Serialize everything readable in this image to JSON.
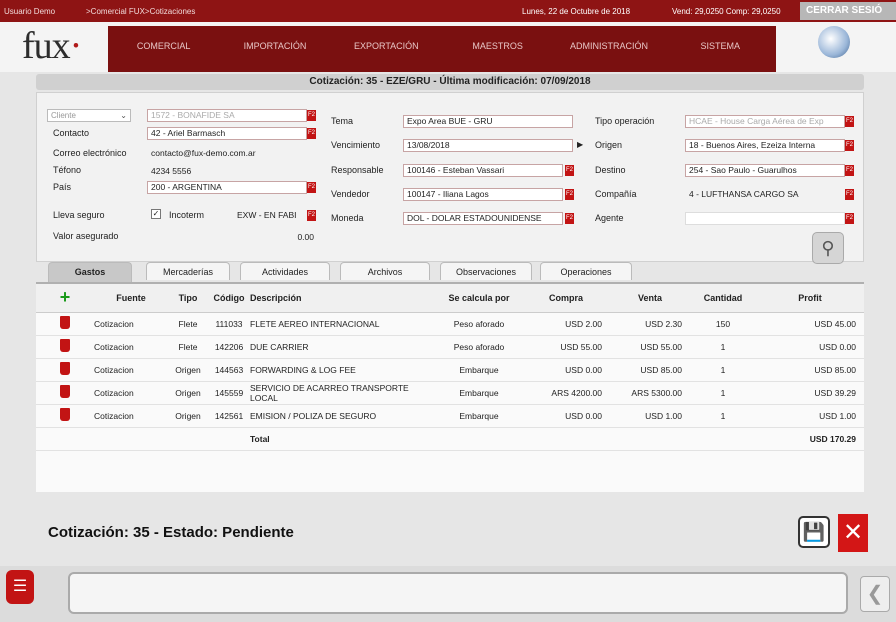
{
  "topbar": {
    "user": "Usuario Demo",
    "breadcrumb": ">Comercial FUX>Cotizaciones",
    "date": "Lunes, 22 de Octubre de 2018",
    "rates": "Vend: 29,0250 Comp: 29,0250",
    "logout": "CERRAR SESIÓ"
  },
  "logo": {
    "text": "fux",
    "dot": "·"
  },
  "nav": [
    "COMERCIAL",
    "IMPORTACIÓN",
    "EXPORTACIÓN",
    "MAESTROS",
    "ADMINISTRACIÓN",
    "SISTEMA"
  ],
  "title": "Cotización: 35 - EZE/GRU - Última modificación: 07/09/2018",
  "form": {
    "cliente_select": "Cliente",
    "cliente": "1572 - BONAFIDE SA",
    "contacto_label": "Contacto",
    "contacto": "42 - Ariel Barmasch",
    "correo_label": "Correo electrónico",
    "correo": "contacto@fux-demo.com.ar",
    "telefono_label": "Téfono",
    "telefono": "4234 5556",
    "pais_label": "País",
    "pais": "200 - ARGENTINA",
    "seguro_label": "Lleva seguro",
    "incoterm_label": "Incoterm",
    "incoterm": "EXW - EN FABI",
    "valor_label": "Valor asegurado",
    "valor": "0.00",
    "tema_label": "Tema",
    "tema": "Expo Area BUE - GRU",
    "venc_label": "Vencimiento",
    "venc": "13/08/2018",
    "resp_label": "Responsable",
    "resp": "100146 - Esteban Vassari",
    "vend_label": "Vendedor",
    "vend": "100147 - Iliana Lagos",
    "moneda_label": "Moneda",
    "moneda": "DOL - DOLAR ESTADOUNIDENSE",
    "tipo_label": "Tipo operación",
    "tipo": "HCAE - House Carga Aérea de Exp",
    "origen_label": "Origen",
    "origen": "18 - Buenos Aires, Ezeiza Interna",
    "destino_label": "Destino",
    "destino": "254 - Sao Paulo - Guarulhos",
    "compania_label": "Compañía",
    "compania": "4 - LUFTHANSA CARGO SA",
    "agente_label": "Agente",
    "agente": ""
  },
  "tabs": [
    "Gastos",
    "Mercaderías",
    "Actividades",
    "Archivos",
    "Observaciones",
    "Operaciones"
  ],
  "table": {
    "headers": [
      "Fuente",
      "Tipo",
      "Código",
      "Descripción",
      "Se calcula por",
      "Compra",
      "Venta",
      "Cantidad",
      "Profit"
    ],
    "rows": [
      [
        "Cotizacion",
        "Flete",
        "111033",
        "FLETE AEREO INTERNACIONAL",
        "Peso aforado",
        "USD 2.00",
        "USD 2.30",
        "150",
        "USD 45.00"
      ],
      [
        "Cotizacion",
        "Flete",
        "142206",
        "DUE CARRIER",
        "Peso aforado",
        "USD 55.00",
        "USD 55.00",
        "1",
        "USD 0.00"
      ],
      [
        "Cotizacion",
        "Origen",
        "144563",
        "FORWARDING & LOG FEE",
        "Embarque",
        "USD 0.00",
        "USD 85.00",
        "1",
        "USD 85.00"
      ],
      [
        "Cotizacion",
        "Origen",
        "145559",
        "SERVICIO DE ACARREO TRANSPORTE LOCAL",
        "Embarque",
        "ARS 4200.00",
        "ARS 5300.00",
        "1",
        "USD 39.29"
      ],
      [
        "Cotizacion",
        "Origen",
        "142561",
        "EMISION / POLIZA DE SEGURO",
        "Embarque",
        "USD 0.00",
        "USD 1.00",
        "1",
        "USD 1.00"
      ]
    ],
    "total_label": "Total",
    "total": "USD 170.29"
  },
  "status": "Cotización: 35 - Estado: Pendiente"
}
